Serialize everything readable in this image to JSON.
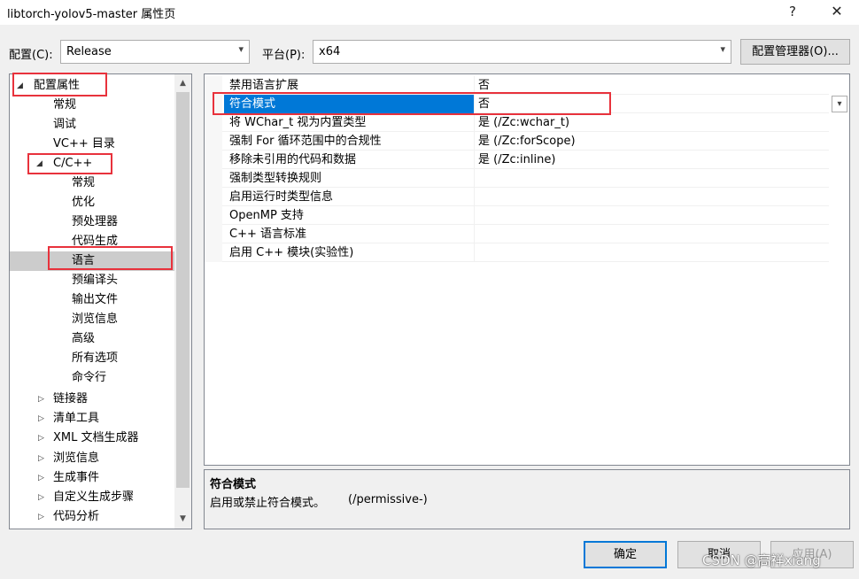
{
  "window": {
    "title": "libtorch-yolov5-master 属性页",
    "help_label": "?",
    "close_label": "✕"
  },
  "toolbar": {
    "config_label": "配置(C):",
    "config_value": "Release",
    "platform_label": "平台(P):",
    "platform_value": "x64",
    "config_manager_label": "配置管理器(O)..."
  },
  "tree": {
    "root_label": "配置属性",
    "items": [
      "常规",
      "调试",
      "VC++ 目录",
      "C/C++",
      "常规",
      "优化",
      "预处理器",
      "代码生成",
      "语言",
      "预编译头",
      "输出文件",
      "浏览信息",
      "高级",
      "所有选项",
      "命令行",
      "链接器",
      "清单工具",
      "XML 文档生成器",
      "浏览信息",
      "生成事件",
      "自定义生成步骤",
      "代码分析"
    ],
    "selected": "语言"
  },
  "properties": [
    {
      "name": "禁用语言扩展",
      "value": "否"
    },
    {
      "name": "符合模式",
      "value": "否"
    },
    {
      "name": "将 WChar_t 视为内置类型",
      "value": "是 (/Zc:wchar_t)"
    },
    {
      "name": "强制 For 循环范围中的合规性",
      "value": "是 (/Zc:forScope)"
    },
    {
      "name": "移除未引用的代码和数据",
      "value": "是 (/Zc:inline)"
    },
    {
      "name": "强制类型转换规则",
      "value": ""
    },
    {
      "name": "启用运行时类型信息",
      "value": ""
    },
    {
      "name": "OpenMP 支持",
      "value": ""
    },
    {
      "name": "C++ 语言标准",
      "value": ""
    },
    {
      "name": "启用 C++ 模块(实验性)",
      "value": ""
    }
  ],
  "description": {
    "title": "符合模式",
    "text": "启用或禁止符合模式。",
    "hint": "(/permissive-)"
  },
  "buttons": {
    "ok": "确定",
    "cancel": "取消",
    "apply": "应用(A)"
  },
  "watermark": "CSDN @高祥xiang",
  "colors": {
    "selection": "#0078d7",
    "highlight_box": "#e8323c",
    "tree_selection": "#cccccc"
  }
}
